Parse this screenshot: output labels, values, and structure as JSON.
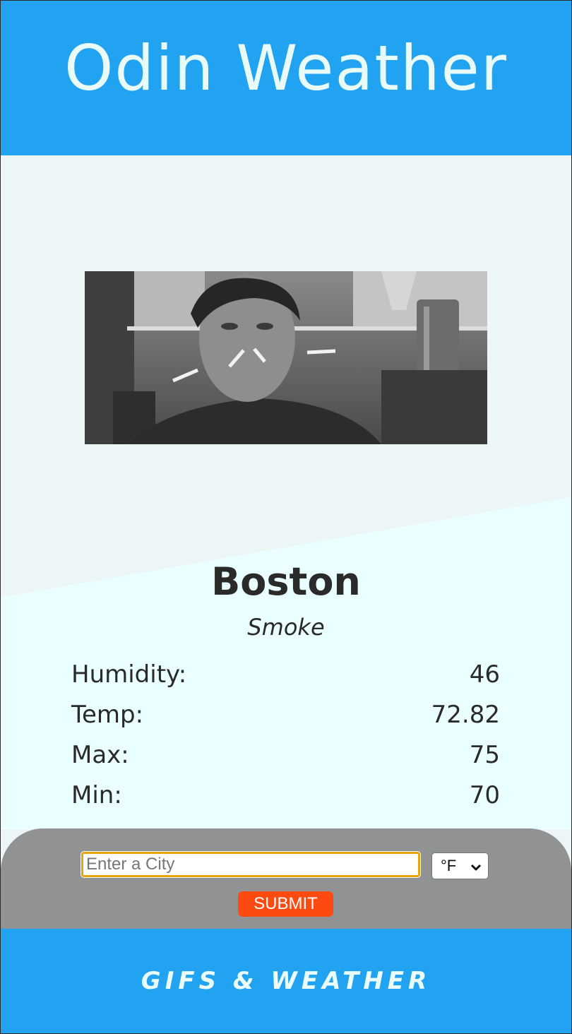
{
  "header": {
    "title": "Odin Weather"
  },
  "gif": {
    "alt": "Weather gif"
  },
  "weather": {
    "city": "Boston",
    "condition": "Smoke",
    "stats": [
      {
        "label": "Humidity:",
        "value": "46"
      },
      {
        "label": "Temp:",
        "value": "72.82"
      },
      {
        "label": "Max:",
        "value": "75"
      },
      {
        "label": "Min:",
        "value": "70"
      }
    ]
  },
  "form": {
    "city_placeholder": "Enter a City",
    "city_value": "",
    "unit_selected": "°F",
    "submit_label": "SUBMIT"
  },
  "footer": {
    "text": "GIFS & WEATHER"
  },
  "colors": {
    "brand_blue": "#22a3f2",
    "submit_orange": "#fd4a11",
    "input_focus": "#e8a40c",
    "form_gray": "#909294"
  }
}
